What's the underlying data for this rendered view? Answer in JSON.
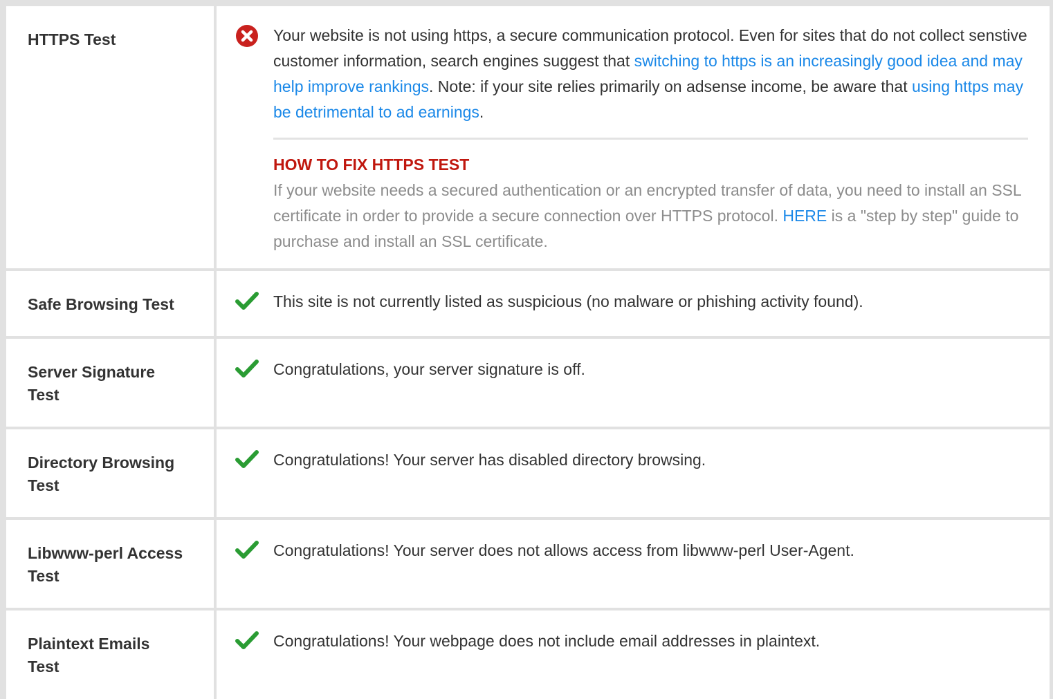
{
  "rows": [
    {
      "label": "HTTPS Test",
      "status": "fail",
      "message_parts": [
        "Your website is not using https, a secure communication protocol. Even for sites that do not collect senstive customer information, search engines suggest that ",
        "switching to https is an increasingly good idea and may help improve rankings",
        ". Note: if your site relies primarily on adsense income, be aware that ",
        "using https may be detrimental to ad earnings",
        "."
      ],
      "fix_title": "HOW TO FIX HTTPS TEST",
      "fix_parts": [
        "If your website needs a secured authentication or an encrypted transfer of data, you need to install an SSL certificate in order to provide a secure connection over HTTPS protocol. ",
        "HERE",
        " is a \"step by step\" guide to purchase and install an SSL certificate."
      ]
    },
    {
      "label": "Safe Browsing Test",
      "status": "pass",
      "message": "This site is not currently listed as suspicious (no malware or phishing activity found)."
    },
    {
      "label": "Server Signature Test",
      "status": "pass",
      "message": "Congratulations, your server signature is off."
    },
    {
      "label": "Directory Browsing Test",
      "status": "pass",
      "message": "Congratulations! Your server has disabled directory browsing."
    },
    {
      "label": "Libwww-perl Access Test",
      "status": "pass",
      "message": "Congratulations! Your server does not allows access from libwww-perl User-Agent."
    },
    {
      "label": "Plaintext Emails Test",
      "status": "pass",
      "message": "Congratulations! Your webpage does not include email addresses in plaintext."
    }
  ],
  "icons": {
    "fail": "error-circle-icon",
    "pass": "checkmark-icon"
  },
  "colors": {
    "fail": "#c9211e",
    "pass": "#2a9c33",
    "link": "#1a88e8",
    "fix_title": "#c0170e"
  }
}
